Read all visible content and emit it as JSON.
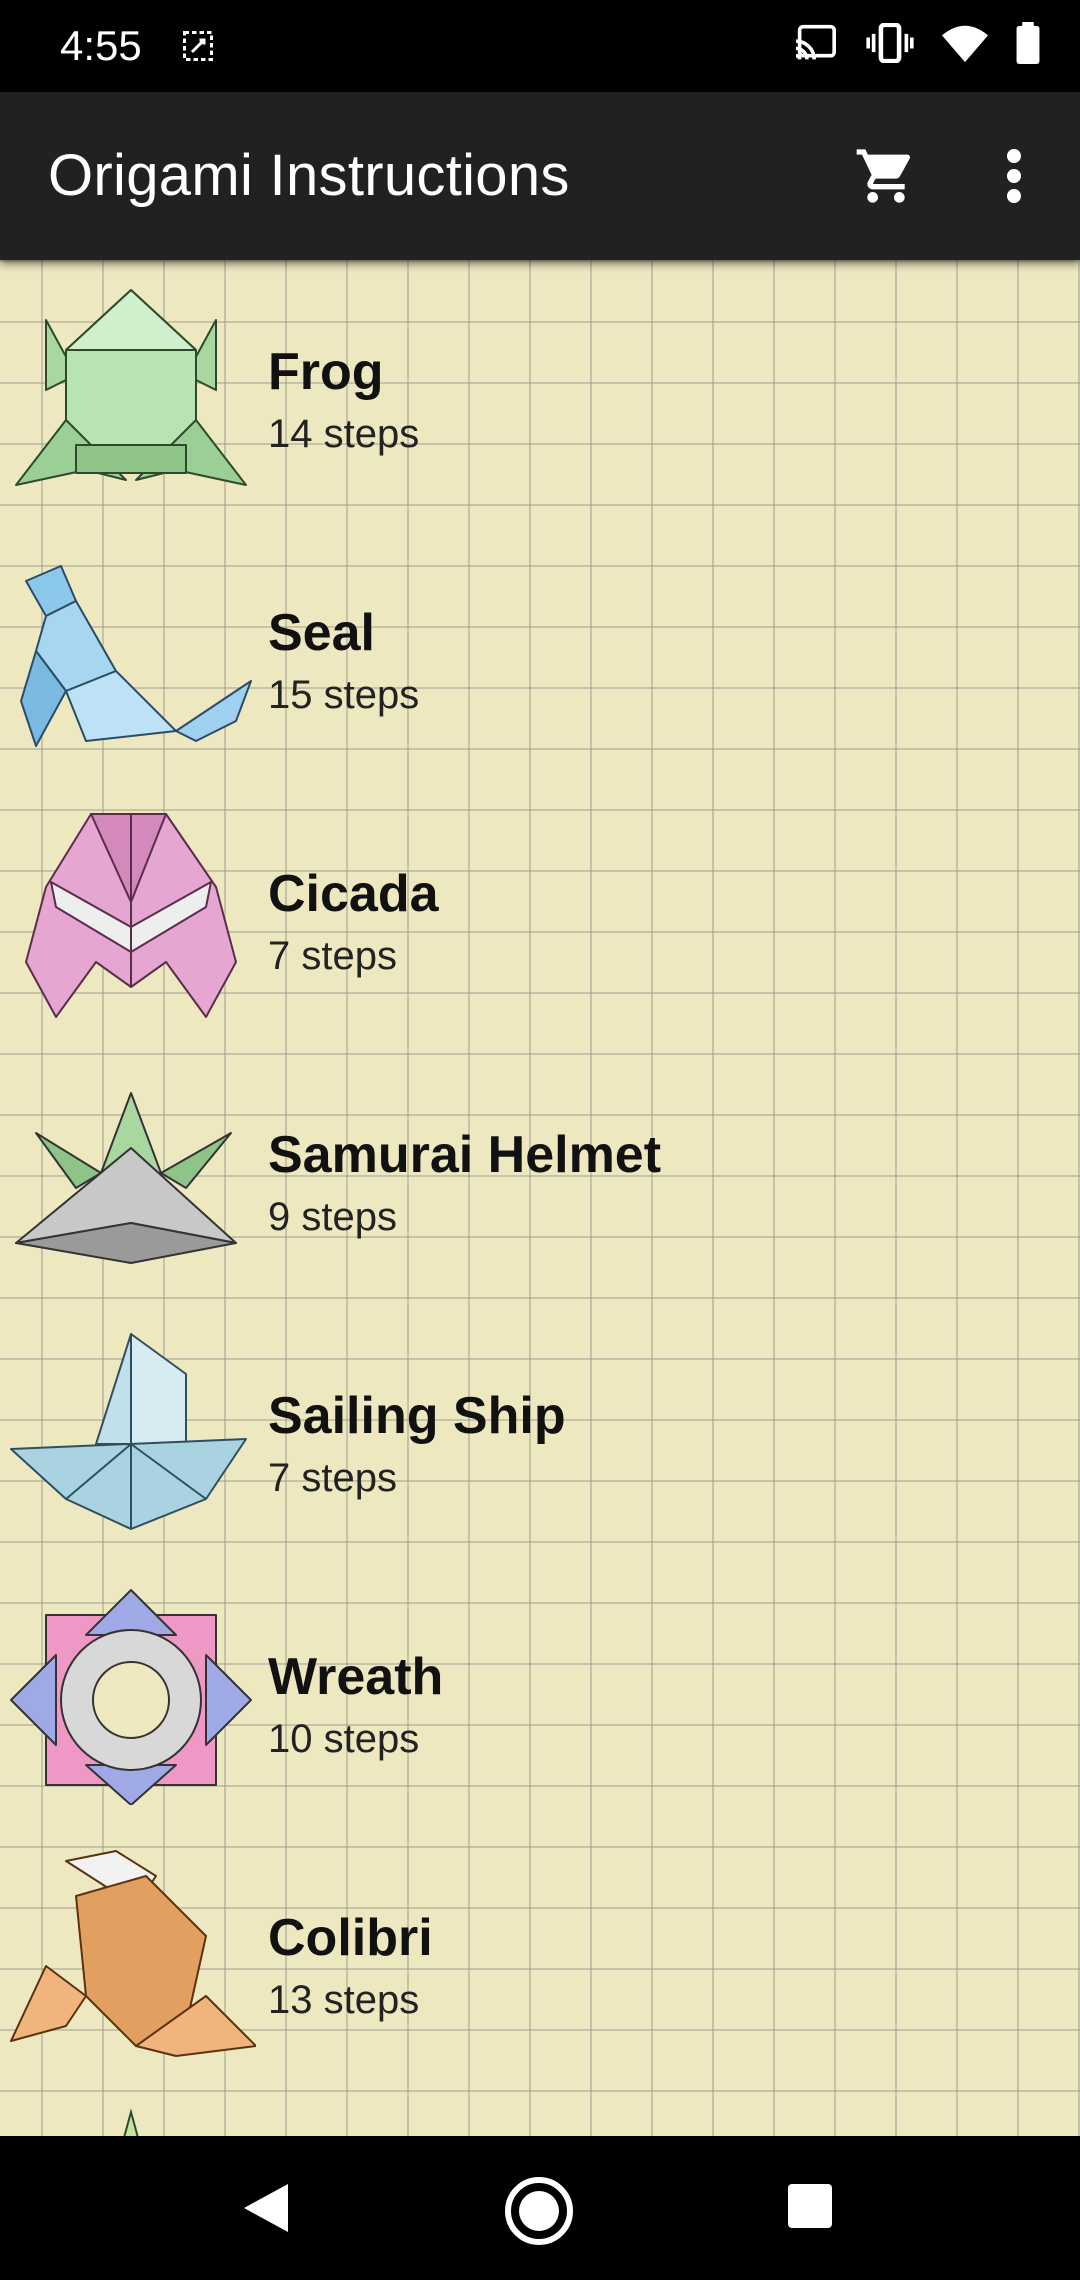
{
  "status_bar": {
    "time": "4:55",
    "left_icon": "screenshot-edit-icon",
    "right_icons": [
      "cast-icon",
      "vibrate-icon",
      "wifi-icon",
      "battery-icon"
    ]
  },
  "app_bar": {
    "title": "Origami Instructions",
    "cart_icon": "shopping-cart-icon",
    "more_icon": "more-vert-icon"
  },
  "colors": {
    "app_bar": "#212121",
    "paper_background": "#eee8c0",
    "grid_line": "#96968c"
  },
  "items": [
    {
      "title": "Frog",
      "steps": "14 steps",
      "icon": "frog-origami-icon"
    },
    {
      "title": "Seal",
      "steps": "15 steps",
      "icon": "seal-origami-icon"
    },
    {
      "title": "Cicada",
      "steps": "7 steps",
      "icon": "cicada-origami-icon"
    },
    {
      "title": "Samurai Helmet",
      "steps": "9 steps",
      "icon": "samurai-helmet-origami-icon"
    },
    {
      "title": "Sailing Ship",
      "steps": "7 steps",
      "icon": "sailing-ship-origami-icon"
    },
    {
      "title": "Wreath",
      "steps": "10 steps",
      "icon": "wreath-origami-icon"
    },
    {
      "title": "Colibri",
      "steps": "13 steps",
      "icon": "colibri-origami-icon"
    }
  ],
  "nav_bar": {
    "back_icon": "back-icon",
    "home_icon": "home-icon",
    "recents_icon": "recents-icon"
  }
}
